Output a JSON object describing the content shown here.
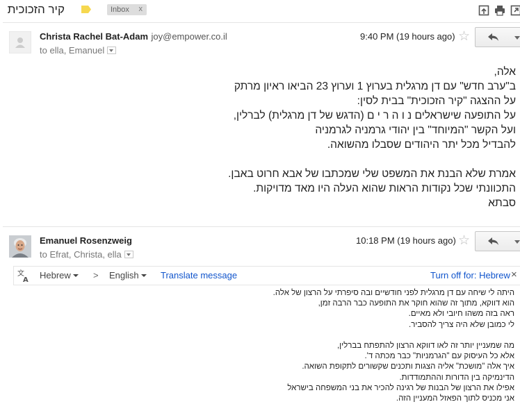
{
  "header": {
    "subject": "קיר הזכוכית",
    "label_chip": "Inbox",
    "label_remove": "x",
    "label_color": "#f6d84f",
    "actions": [
      "archive-icon",
      "print-icon",
      "new-window-icon"
    ]
  },
  "messages": [
    {
      "sender_name": "Christa Rachel Bat-Adam",
      "sender_email": "joy@empower.co.il",
      "to_prefix": "to",
      "recipients": "ella, Emanuel",
      "time": "9:40 PM (19 hours ago)",
      "body": [
        "אלה,",
        "ב\"ערב חדש\" עם דן מרגלית בערוץ 1 וערוץ 23 הביאו ראיון מרתק",
        "על ההצגה \"קיר הזכוכית\" בבית לסין:",
        "על התופעה שישראלים  נ ו ה ר י ם  (הדגש של דן מרגלית) לברלין,",
        "ועל הקשר \"המיוחד\" בין יהודי גרמניה לגרמניה",
        "להבדיל מכל יתר היהודים שסבלו מהשואה.",
        "",
        "אמרת שלא הבנת את המשפט שלי שמכתבו של אבא חרוט באבן.",
        "התכוונתי שכל נקודות הראות שהוא העלה היו מאד מדויקות.",
        "סבתא"
      ]
    },
    {
      "sender_name": "Emanuel Rosenzweig",
      "to_prefix": "to",
      "recipients": "Efrat, Christa, ella",
      "time": "10:18 PM (19 hours ago)",
      "body": [
        "היתה לי שיחה עם דן מרגלית לפני חודשיים ובה סיפרתי על הרצון של אלה.",
        "הוא דווקא, מתוך זה שהוא חוקר את התופעה כבר הרבה זמן,",
        "ראה בזה משהו חיובי ולא מאיים.",
        "לי כמובן שלא היה צריך להסביר.",
        "",
        "מה שמעניין יותר זה לאו דווקא הרצון להתפתח בברלין,",
        "אלא כל העיסוק עם \"הגרמניות\" כבר מכתה ד'.",
        "איך אלה \"מושכת\" אליה הצגות ותכנים שקשורים לתקופת השואה.",
        "הדינמיקה בין הדורות וההתמודדות.",
        "אפילו את הרצון של הבנות של רגינה להכיר את בני המשפחה בישראל",
        "אני מכניס לתוך הפאזל המעניין הזה."
      ]
    }
  ],
  "translate": {
    "from_lang": "Hebrew",
    "arrow": ">",
    "to_lang": "English",
    "translate_link": "Translate message",
    "turn_off": "Turn off for: Hebrew",
    "close": "×"
  }
}
